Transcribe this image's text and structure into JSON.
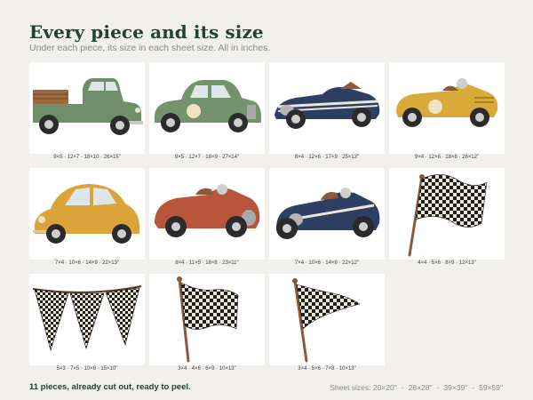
{
  "header": {
    "title": "Every piece and its size",
    "subtitle": "Under each piece, its size in each sheet size. All in inches."
  },
  "pieces": [
    {
      "name": "green-pickup-truck",
      "sizes": "9×5 · 12×7 · 18×10 · 26×15\""
    },
    {
      "name": "green-vintage-car",
      "sizes": "9×5 · 12×7 · 18×9 · 27×14\""
    },
    {
      "name": "blue-roadster",
      "sizes": "8×4 · 12×6 · 17×9 · 25×13\""
    },
    {
      "name": "yellow-race-car",
      "sizes": "9×4 · 12×6 · 18×8 · 26×12\""
    },
    {
      "name": "yellow-beetle",
      "sizes": "7×4 · 10×6 · 14×9 · 22×13\""
    },
    {
      "name": "red-race-car",
      "sizes": "8×4 · 11×5 · 16×8 · 23×11\""
    },
    {
      "name": "blue-race-car",
      "sizes": "7×4 · 10×6 · 14×8 · 22×12\""
    },
    {
      "name": "checkered-flag-large",
      "sizes": "4×4 · 5×6 · 8×9 · 12×13\""
    },
    {
      "name": "checkered-bunting",
      "sizes": "5×3 · 7×5 · 10×6 · 15×10\""
    },
    {
      "name": "checkered-flag-medium",
      "sizes": "3×4 · 4×6 · 6×9 · 10×13\""
    },
    {
      "name": "checkered-flag-small",
      "sizes": "3×4 · 5×6 · 7×8 · 10×13\""
    }
  ],
  "footer": {
    "summary": "11 pieces, already cut out, ready to peel.",
    "sheet_sizes_label": "Sheet sizes:",
    "sheet_sizes": [
      "20×20\"",
      "28×28\"",
      "39×39\"",
      "59×59\""
    ]
  },
  "colors": {
    "background": "#f1f0ec",
    "title": "#24432c",
    "green": "#6f8f6a",
    "navy": "#2d3f63",
    "mustard": "#d9a93a",
    "rust": "#b9553a"
  }
}
